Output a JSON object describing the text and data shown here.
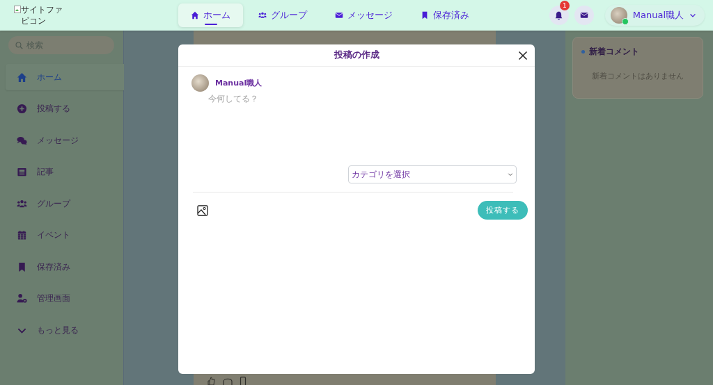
{
  "header": {
    "logo_alt": "サイトファビコン",
    "nav": [
      {
        "label": "ホーム",
        "kind": "house",
        "selected": true
      },
      {
        "label": "グループ",
        "kind": "people",
        "selected": false
      },
      {
        "label": "メッセージ",
        "kind": "envelope",
        "selected": false
      },
      {
        "label": "保存済み",
        "kind": "bookmark",
        "selected": false
      }
    ],
    "notification_count": "1",
    "user": {
      "name": "Manual職人",
      "online": true
    }
  },
  "sidebar": {
    "search_placeholder": "検索",
    "items": [
      {
        "label": "ホーム",
        "kind": "house",
        "selected": true
      },
      {
        "label": "投稿する",
        "kind": "plus-circle",
        "selected": false
      },
      {
        "label": "メッセージ",
        "kind": "chat",
        "selected": false
      },
      {
        "label": "記事",
        "kind": "newspaper",
        "selected": false
      },
      {
        "label": "グループ",
        "kind": "people",
        "selected": false
      },
      {
        "label": "イベント",
        "kind": "calendar",
        "selected": false
      },
      {
        "label": "保存済み",
        "kind": "bookmark",
        "selected": false
      },
      {
        "label": "管理画面",
        "kind": "person-gear",
        "selected": false
      },
      {
        "label": "もっと見る",
        "kind": "chevron",
        "selected": false
      }
    ]
  },
  "comments_panel": {
    "title": "新着コメント",
    "empty_text": "新着コメントはありません"
  },
  "modal": {
    "title": "投稿の作成",
    "user_name": "Manual職人",
    "placeholder": "今何してる？",
    "category": "カテゴリを選択",
    "post_button": "投稿する"
  }
}
